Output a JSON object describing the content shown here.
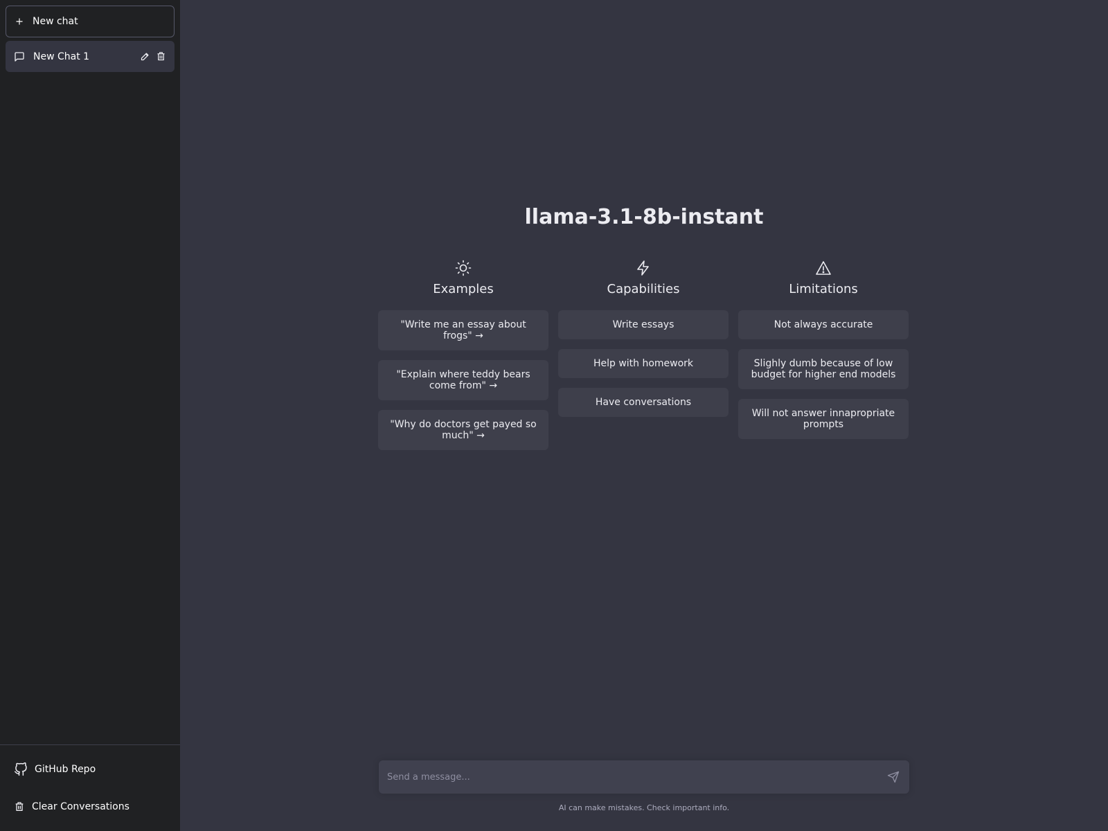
{
  "sidebar": {
    "new_chat_label": "New chat",
    "chats": [
      {
        "label": "New Chat 1"
      }
    ],
    "footer": {
      "github_label": "GitHub Repo",
      "clear_label": "Clear Conversations"
    }
  },
  "main": {
    "model_title": "llama-3.1-8b-instant",
    "columns": [
      {
        "icon": "sun-icon",
        "title": "Examples",
        "items": [
          "\"Write me an essay about frogs\" →",
          "\"Explain where teddy bears come from\" →",
          "\"Why do doctors get payed so much\" →"
        ]
      },
      {
        "icon": "lightning-icon",
        "title": "Capabilities",
        "items": [
          "Write essays",
          "Help with homework",
          "Have conversations"
        ]
      },
      {
        "icon": "warning-icon",
        "title": "Limitations",
        "items": [
          "Not always accurate",
          "Slighly dumb because of low budget for higher end models",
          "Will not answer innapropriate prompts"
        ]
      }
    ],
    "input": {
      "placeholder": "Send a message..."
    },
    "disclaimer": "AI can make mistakes. Check important info."
  },
  "colors": {
    "sidebar_bg": "#202123",
    "main_bg": "#343541",
    "card_bg": "#3e3f4b",
    "input_bg": "#40414f"
  }
}
